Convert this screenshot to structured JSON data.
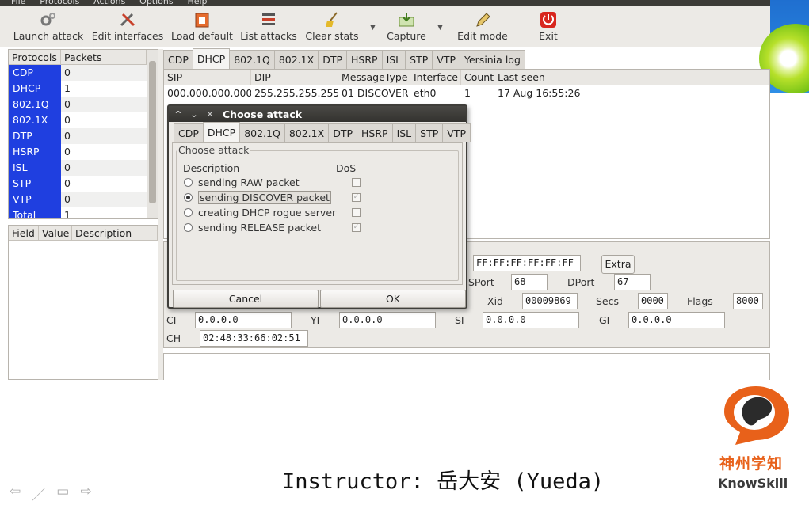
{
  "menubar": {
    "items": [
      "File",
      "Protocols",
      "Actions",
      "Options",
      "Help"
    ]
  },
  "toolbar": {
    "items": [
      {
        "label": "Launch attack",
        "icon": "gears-icon"
      },
      {
        "label": "Edit interfaces",
        "icon": "tools-icon"
      },
      {
        "label": "Load default",
        "icon": "load-icon"
      },
      {
        "label": "List attacks",
        "icon": "list-icon"
      },
      {
        "label": "Clear stats",
        "icon": "broom-icon"
      },
      {
        "label": "Capture",
        "icon": "capture-icon"
      },
      {
        "label": "Edit mode",
        "icon": "pencil-icon"
      },
      {
        "label": "Exit",
        "icon": "power-icon"
      }
    ]
  },
  "protocols": {
    "headers": [
      "Protocols",
      "Packets"
    ],
    "rows": [
      {
        "name": "CDP",
        "count": "0"
      },
      {
        "name": "DHCP",
        "count": "1"
      },
      {
        "name": "802.1Q",
        "count": "0"
      },
      {
        "name": "802.1X",
        "count": "0"
      },
      {
        "name": "DTP",
        "count": "0"
      },
      {
        "name": "HSRP",
        "count": "0"
      },
      {
        "name": "ISL",
        "count": "0"
      },
      {
        "name": "STP",
        "count": "0"
      },
      {
        "name": "VTP",
        "count": "0"
      },
      {
        "name": "Total",
        "count": "1"
      }
    ]
  },
  "fields": {
    "headers": [
      "Field",
      "Value",
      "Description"
    ]
  },
  "main_tabs": [
    "CDP",
    "DHCP",
    "802.1Q",
    "802.1X",
    "DTP",
    "HSRP",
    "ISL",
    "STP",
    "VTP",
    "Yersinia log"
  ],
  "packets": {
    "headers": [
      "SIP",
      "DIP",
      "MessageType",
      "Interface",
      "Count",
      "Last seen"
    ],
    "rows": [
      [
        "000.000.000.000",
        "255.255.255.255",
        "01 DISCOVER",
        "eth0",
        "1",
        "17 Aug 16:55:26"
      ]
    ]
  },
  "detail": {
    "mac": "FF:FF:FF:FF:FF:FF",
    "extra_label": "Extra",
    "sport_label": "SPort",
    "sport": "68",
    "dport_label": "DPort",
    "dport": "67",
    "xid_label": "Xid",
    "xid": "00009869",
    "secs_label": "Secs",
    "secs": "0000",
    "flags_label": "Flags",
    "flags": "8000",
    "ci_label": "CI",
    "ci": "0.0.0.0",
    "yi_label": "YI",
    "yi": "0.0.0.0",
    "si_label": "SI",
    "si": "0.0.0.0",
    "gi_label": "GI",
    "gi": "0.0.0.0",
    "ch_label": "CH",
    "ch": "02:48:33:66:02:51"
  },
  "dialog": {
    "title": "Choose attack",
    "tabs": [
      "CDP",
      "DHCP",
      "802.1Q",
      "802.1X",
      "DTP",
      "HSRP",
      "ISL",
      "STP",
      "VTP"
    ],
    "group_label": "Choose attack",
    "col_description": "Description",
    "col_dos": "DoS",
    "attacks": [
      {
        "label": "sending RAW packet",
        "selected": false,
        "dos": false
      },
      {
        "label": "sending DISCOVER packet",
        "selected": true,
        "dos": true
      },
      {
        "label": "creating DHCP rogue server",
        "selected": false,
        "dos": false
      },
      {
        "label": "sending RELEASE packet",
        "selected": false,
        "dos": true
      }
    ],
    "cancel_label": "Cancel",
    "ok_label": "OK"
  },
  "footer": {
    "instructor": "Instructor: 岳大安 (Yueda)",
    "brand_cn": "神州学知",
    "brand_en": "KnowSkill"
  },
  "colors": {
    "protocol_blue": "#1f3fe0",
    "brand_orange": "#e8611a",
    "exit_red": "#d8261e"
  }
}
